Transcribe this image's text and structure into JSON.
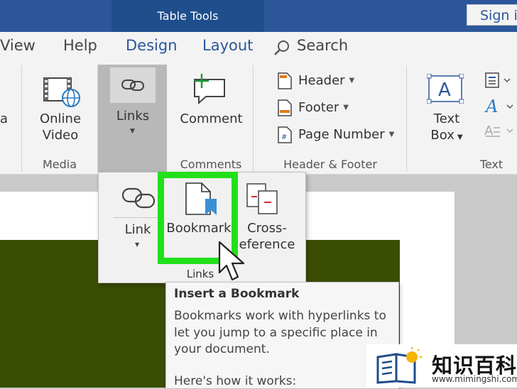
{
  "titlebar": {
    "context_tab": "Table Tools",
    "sign_in": "Sign in"
  },
  "tabs": [
    {
      "label": "View"
    },
    {
      "label": "Help"
    },
    {
      "label": "Design"
    },
    {
      "label": "Layout"
    },
    {
      "label": "Search"
    }
  ],
  "ribbon": {
    "partial_left": "a",
    "online_video": {
      "line1": "Online",
      "line2": "Video"
    },
    "links_button": "Links",
    "comment": "Comment",
    "header": "Header",
    "footer": "Footer",
    "page_number": "Page Number",
    "text_box": {
      "line1": "Text",
      "line2": "Box"
    },
    "group_labels": {
      "media": "Media",
      "comments": "Comments",
      "header_footer": "Header & Footer",
      "text": "Text"
    }
  },
  "dropdown": {
    "link": "Link",
    "bookmark": "Bookmark",
    "cross_reference": {
      "line1": "Cross-",
      "line2": "eference"
    },
    "group_label": "Links"
  },
  "tooltip": {
    "title": "Insert a Bookmark",
    "body_lines": [
      "Bookmarks work with hyperlinks to",
      "let you jump to a specific place in",
      "your document."
    ],
    "more": "Here's how it works:"
  },
  "watermark": {
    "title": "知识百科",
    "url": "www.mimingshi.com"
  },
  "colors": {
    "ribbon_blue": "#2b579a",
    "highlight_green": "#22e01a",
    "document_green": "#3a4d02"
  }
}
